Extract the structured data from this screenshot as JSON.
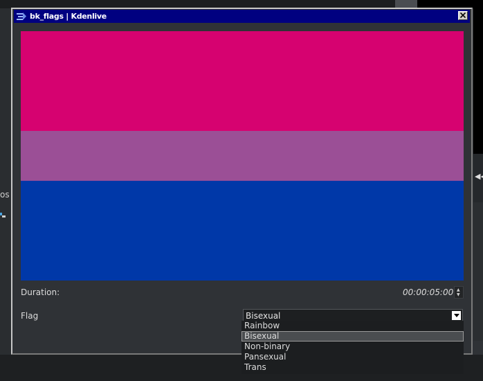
{
  "window": {
    "title": "bk_flags | Kdenlive"
  },
  "preview": {
    "stripes": [
      {
        "color": "#D60270",
        "share": 0.4
      },
      {
        "color": "#9B4F96",
        "share": 0.2
      },
      {
        "color": "#0038A8",
        "share": 0.4
      }
    ]
  },
  "duration": {
    "label": "Duration:",
    "value": "00:00:05:00"
  },
  "flag": {
    "label": "Flag",
    "selected": "Bisexual",
    "options": [
      "Rainbow",
      "Bisexual",
      "Non-binary",
      "Pansexual",
      "Trans"
    ],
    "selected_index": 1
  },
  "background": {
    "left_text": "os"
  },
  "colors": {
    "titlebar": "#000080",
    "dialog_bg": "#2f3236"
  }
}
